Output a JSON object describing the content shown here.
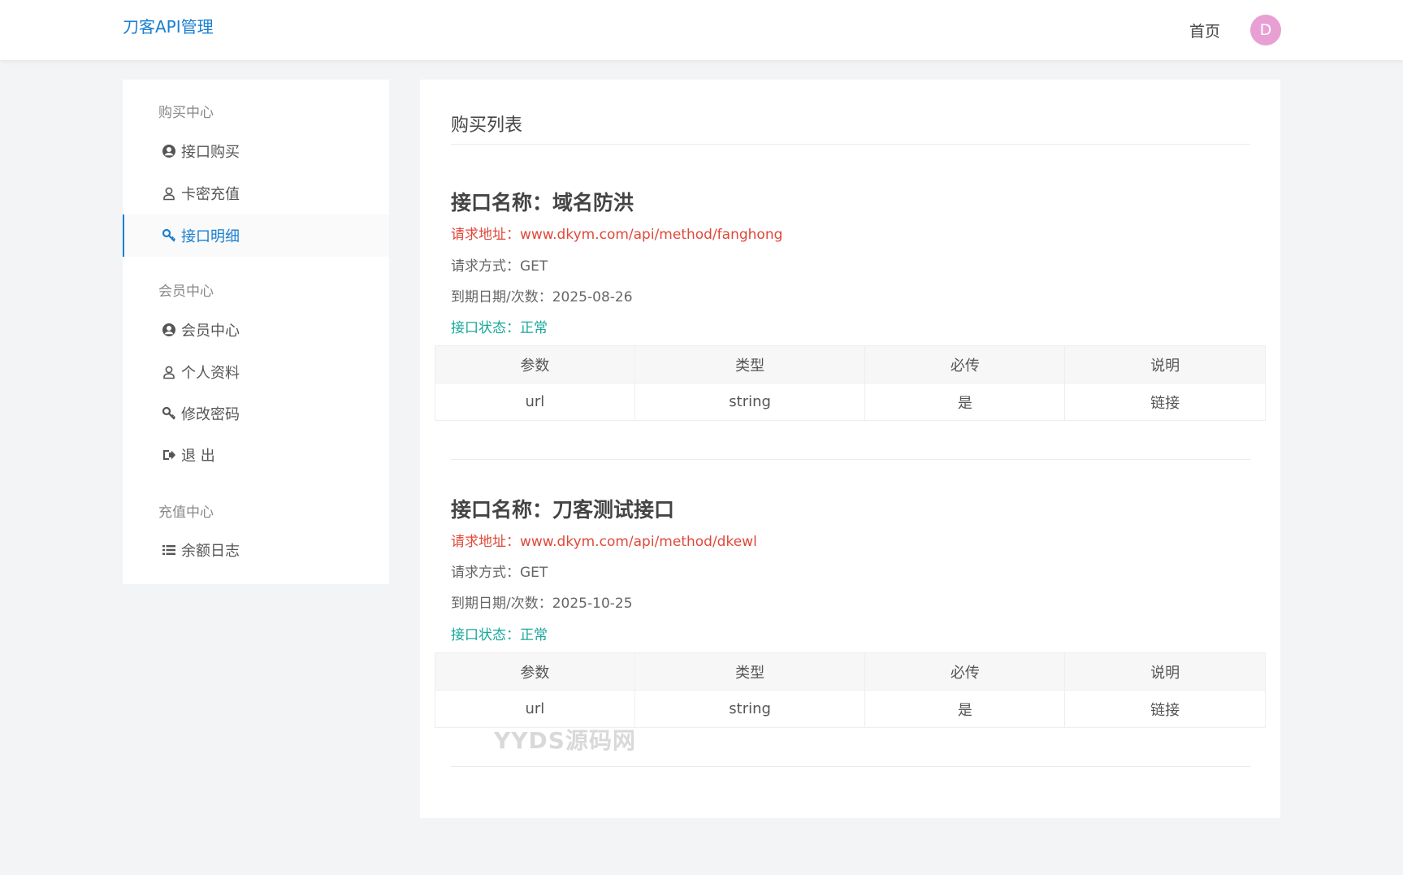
{
  "header": {
    "brand": "刀客API管理",
    "nav_home": "首页",
    "avatar_letter": "D"
  },
  "sidebar": {
    "sections": [
      {
        "title": "购买中心",
        "items": [
          {
            "label": "接口购买",
            "icon": "user-circle-icon"
          },
          {
            "label": "卡密充值",
            "icon": "user-outline-icon"
          },
          {
            "label": "接口明细",
            "icon": "key-icon",
            "active": true
          }
        ]
      },
      {
        "title": "会员中心",
        "items": [
          {
            "label": "会员中心",
            "icon": "user-circle-icon"
          },
          {
            "label": "个人资料",
            "icon": "user-outline-icon"
          },
          {
            "label": "修改密码",
            "icon": "key-icon"
          },
          {
            "label": "退 出",
            "icon": "sign-out-icon"
          }
        ]
      },
      {
        "title": "充值中心",
        "items": [
          {
            "label": "余额日志",
            "icon": "list-icon"
          }
        ]
      }
    ]
  },
  "main": {
    "title": "购买列表",
    "apis": [
      {
        "name": "接口名称：域名防洪",
        "url_label": "请求地址：",
        "url": "www.dkym.com/api/method/fanghong",
        "method_label": "请求方式：",
        "method": "GET",
        "expire_label": "到期日期/次数：",
        "expire": "2025-08-26",
        "status_label": "接口状态：",
        "status": "正常",
        "columns": [
          "参数",
          "类型",
          "必传",
          "说明"
        ],
        "rows": [
          [
            "url",
            "string",
            "是",
            "链接"
          ]
        ]
      },
      {
        "name": "接口名称：刀客测试接口",
        "url_label": "请求地址：",
        "url": "www.dkym.com/api/method/dkewl",
        "method_label": "请求方式：",
        "method": "GET",
        "expire_label": "到期日期/次数：",
        "expire": "2025-10-25",
        "status_label": "接口状态：",
        "status": "正常",
        "columns": [
          "参数",
          "类型",
          "必传",
          "说明"
        ],
        "rows": [
          [
            "url",
            "string",
            "是",
            "链接"
          ]
        ]
      }
    ]
  },
  "watermark": "YYDS源码网",
  "colors": {
    "accent": "#1a7fd0",
    "url_red": "#e0483a",
    "status_green": "#19a89a",
    "avatar_bg": "#e8a0d4"
  }
}
